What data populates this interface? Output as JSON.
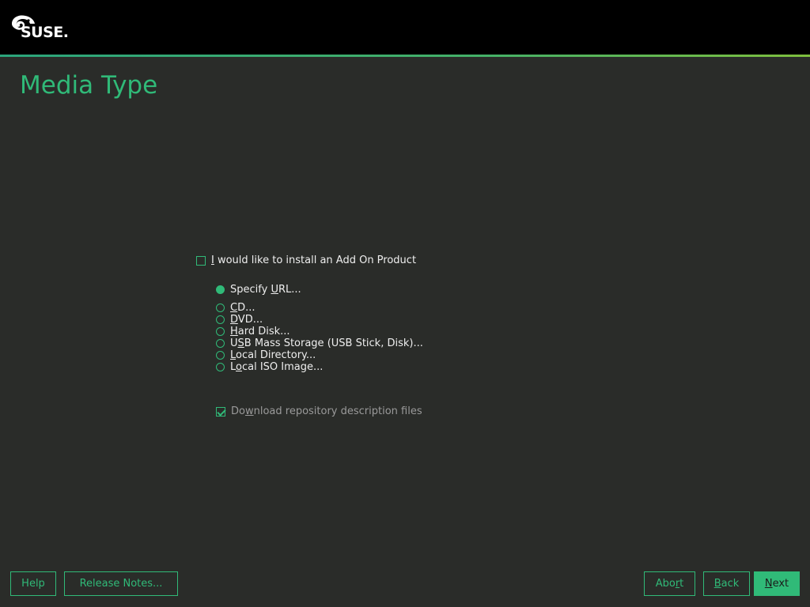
{
  "header": {
    "brand": "SUSE."
  },
  "page": {
    "title": "Media Type"
  },
  "addon": {
    "checkbox_u": "I",
    "checkbox_rest": " would like to install an Add On Product",
    "checked": false
  },
  "media_options": [
    {
      "pre": "Specify ",
      "u": "U",
      "post": "RL...",
      "selected": true
    },
    {
      "pre": "",
      "u": "C",
      "post": "D...",
      "selected": false
    },
    {
      "pre": "",
      "u": "D",
      "post": "VD...",
      "selected": false
    },
    {
      "pre": "",
      "u": "H",
      "post": "ard Disk...",
      "selected": false
    },
    {
      "pre": "U",
      "u": "S",
      "post": "B Mass Storage (USB Stick, Disk)...",
      "selected": false
    },
    {
      "pre": "",
      "u": "L",
      "post": "ocal Directory...",
      "selected": false
    },
    {
      "pre": "L",
      "u": "o",
      "post": "cal ISO Image...",
      "selected": false
    }
  ],
  "download": {
    "pre": "Do",
    "u": "w",
    "post": "nload repository description files",
    "checked": true
  },
  "footer": {
    "help": "Help",
    "release_notes": "Release Notes...",
    "abort_pre": "Abo",
    "abort_u": "r",
    "abort_post": "t",
    "back_u": "B",
    "back_post": "ack",
    "next_u": "N",
    "next_post": "ext"
  },
  "colors": {
    "accent": "#30ba78",
    "background": "#2a2c29",
    "header": "#000000"
  }
}
